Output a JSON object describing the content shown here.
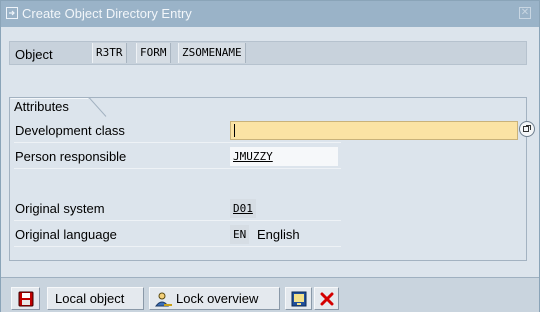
{
  "window": {
    "title": "Create Object Directory Entry"
  },
  "object": {
    "label": "Object",
    "pgmid": "R3TR",
    "type": "FORM",
    "name": "ZSOMENAME"
  },
  "attributes": {
    "tab_label": "Attributes",
    "development_class": {
      "label": "Development class",
      "value": ""
    },
    "person_responsible": {
      "label": "Person responsible",
      "value": "JMUZZY"
    },
    "original_system": {
      "label": "Original system",
      "value": "D01"
    },
    "original_language": {
      "label": "Original language",
      "key": "EN",
      "name": "English"
    }
  },
  "toolbar": {
    "save_icon": "floppy-disk-icon",
    "local_object_label": "Local object",
    "lock_overview_label": "Lock overview",
    "lock_icon": "users-icon",
    "display_icon": "display-object-icon",
    "cancel_icon": "red-x-icon"
  },
  "colors": {
    "titlebar": "#9ab3c8",
    "dialog_bg": "#dce4ec",
    "required_input": "#fbe3a4",
    "cancel_red": "#d40000"
  }
}
